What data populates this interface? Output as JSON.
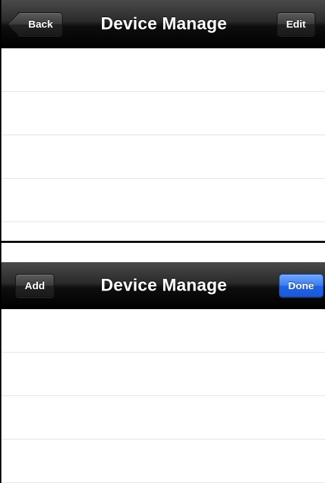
{
  "top_screen": {
    "title": "Device Manage",
    "left_button": "Back",
    "right_button": "Edit",
    "rows": [
      "",
      "",
      "",
      ""
    ]
  },
  "bottom_screen": {
    "title": "Device Manage",
    "left_button": "Add",
    "right_button": "Done",
    "rows": [
      "",
      "",
      "",
      ""
    ]
  },
  "colors": {
    "navbar": "#000000",
    "done_button": "#1f63e6",
    "row_separator": "#e3e3e3"
  }
}
